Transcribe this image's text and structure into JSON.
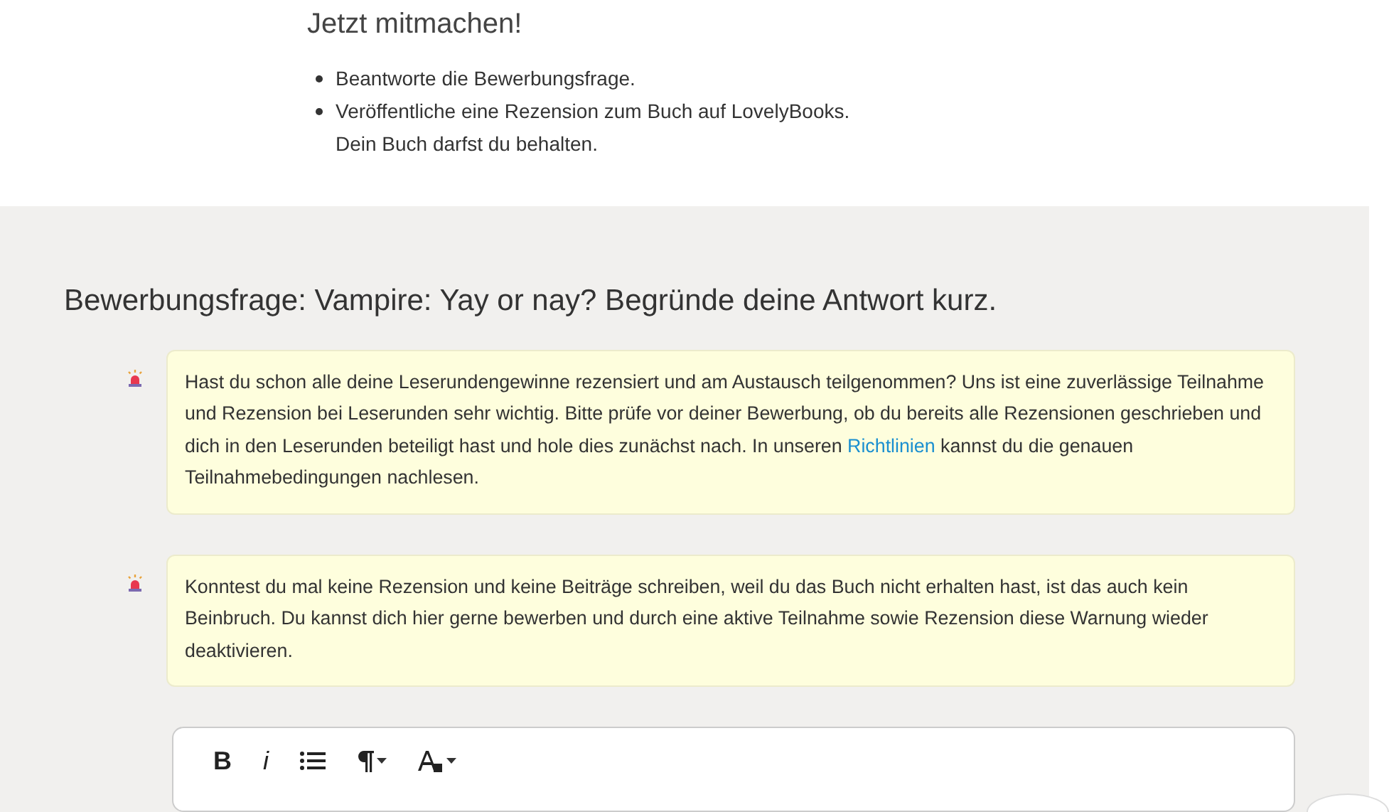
{
  "intro": {
    "title": "Jetzt mitmachen!",
    "steps": [
      "Beantworte die Bewerbungsfrage.",
      "Veröffentliche eine Rezension zum Buch auf LovelyBooks.\nDein Buch darfst du behalten."
    ]
  },
  "question": "**Bewerbungsfrage:** Vampire: Yay or nay? Begründe deine Antwort kurz.",
  "notices": [
    {
      "text_before": "Hast du schon alle deine Leserundengewinne rezensiert und am Austausch teilgenommen? Uns ist eine zuverlässige Teilnahme und Rezension bei Leserunden sehr wichtig. Bitte prüfe vor deiner Bewerbung, ob du bereits alle Rezensionen geschrieben und dich in den Leserunden beteiligt hast und hole dies zunächst nach. In unseren ",
      "link": "Richtlinien",
      "text_after": " kannst du die genauen Teilnahmebedingungen nachlesen."
    },
    {
      "text_before": "Konntest du mal keine Rezension und keine Beiträge schreiben, weil du das Buch nicht erhalten hast, ist das auch kein Beinbruch. Du kannst dich hier gerne bewerben und durch eine aktive Teilnahme sowie Rezension diese Warnung wieder deaktivieren."
    }
  ],
  "editor_toolbar": [
    {
      "kind": "bold",
      "label": "B"
    },
    {
      "kind": "italic",
      "label": "i"
    },
    {
      "kind": "list"
    },
    {
      "kind": "paragraph"
    },
    {
      "kind": "text-style"
    }
  ]
}
